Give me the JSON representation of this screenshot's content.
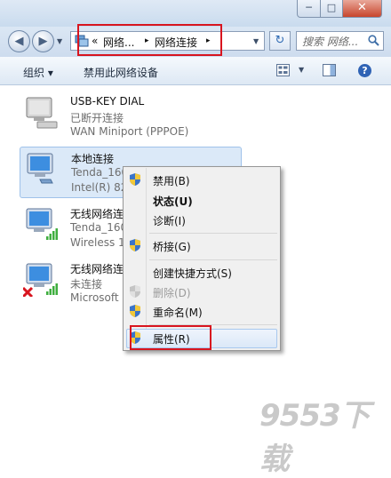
{
  "window": {
    "min_label": "─",
    "max_label": "□",
    "close_label": "✕"
  },
  "address": {
    "prefix": "«",
    "crumbs": [
      "网络...",
      "网络连接"
    ],
    "sep": "▸",
    "search_placeholder": "搜索 网络..."
  },
  "toolbar": {
    "organize": "组织 ▾",
    "disable_device": "禁用此网络设备",
    "help": "?"
  },
  "connections": [
    {
      "name": "USB-KEY DIAL",
      "status": "已断开连接",
      "device": "WAN Miniport (PPPOE)"
    },
    {
      "name": "本地连接",
      "status": "Tenda_160",
      "device": "Intel(R) 82"
    },
    {
      "name": "无线网络连",
      "status": "Tenda_160",
      "device": "Wireless 1"
    },
    {
      "name": "无线网络连",
      "status": "未连接",
      "device": "Microsoft"
    }
  ],
  "context_menu": {
    "items": [
      {
        "label": "禁用(B)"
      },
      {
        "label": "状态(U)"
      },
      {
        "label": "诊断(I)"
      },
      {
        "label": "桥接(G)"
      },
      {
        "label": "创建快捷方式(S)"
      },
      {
        "label": "删除(D)"
      },
      {
        "label": "重命名(M)"
      },
      {
        "label": "属性(R)"
      }
    ]
  },
  "watermark": "9553下载",
  "colors": {
    "highlight_red": "#d8151f",
    "selection_blue": "#dbe9f8",
    "menu_bg": "#f0f0f0"
  }
}
